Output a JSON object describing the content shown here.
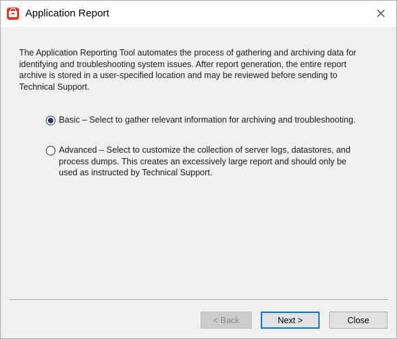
{
  "window": {
    "title": "Application Report"
  },
  "description": "The Application Reporting Tool automates the process of gathering and archiving data for identifying and troubleshooting system issues. After report generation, the entire report archive is stored in a user-specified location and may be reviewed before sending to Technical Support.",
  "options": {
    "basic": {
      "label": "Basic – Select to gather relevant information for archiving and troubleshooting.",
      "selected": true
    },
    "advanced": {
      "label": "Advanced – Select to customize the collection of server logs, datastores, and process dumps. This creates an excessively large report and should only be used as instructed by Technical Support.",
      "selected": false
    }
  },
  "buttons": {
    "back": "< Back",
    "next": "Next >",
    "close": "Close"
  },
  "colors": {
    "accent": "#0078d7",
    "app_icon": "#e8362b"
  }
}
